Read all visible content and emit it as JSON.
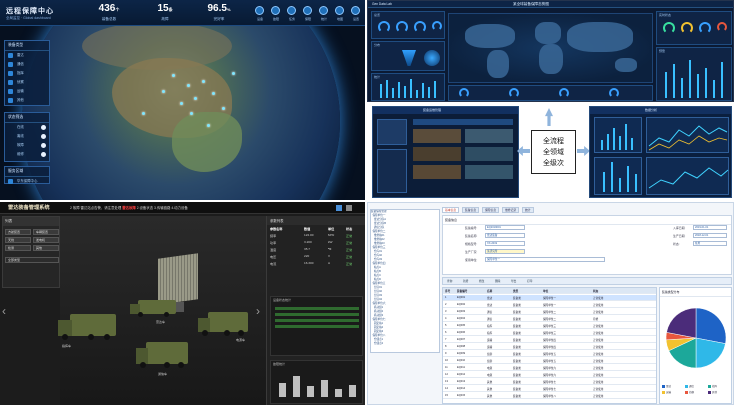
{
  "q1": {
    "title": "远程保障中心",
    "subtitle": "全局监控 · Global dashboard",
    "stats": [
      {
        "num": "436",
        "unit": "个",
        "label": "装备总数"
      },
      {
        "num": "15",
        "unit": "条",
        "label": "故障"
      },
      {
        "num": "96.5",
        "unit": "%",
        "label": "完好率"
      }
    ],
    "top_icons": [
      "设备",
      "故障",
      "任务",
      "保障",
      "统计",
      "地图",
      "设置"
    ],
    "panel1": {
      "title": "装备类型",
      "items": [
        "雷达",
        "通信",
        "指挥",
        "侦察",
        "运输",
        "其他"
      ]
    },
    "panel2": {
      "title": "状态筛选",
      "items": [
        "在线",
        "离线",
        "故障",
        "维修"
      ]
    },
    "panel3": {
      "title": "服务区域",
      "items": [
        "华东保障中心"
      ]
    }
  },
  "q2": {
    "logo": "Gen Data Lab",
    "title": "某全球装备保障态势图",
    "panels_left": [
      "总览",
      "分布",
      "统计"
    ],
    "panels_right": [
      "实时状态",
      "预警"
    ]
  },
  "q3": {
    "center": [
      "全流程",
      "全领域",
      "全级次"
    ],
    "left_title": "装备运维管理",
    "right_title": "数据分析"
  },
  "q4": {
    "title": "雷达装备管理系统",
    "ticker_prefix": "2 故障  雷达站点告警，请注意处理  ",
    "ticker_warn": "雷达故障",
    "ticker_suffix": "  2.设备状态 3.传输链路  4.动力设备",
    "left_header": "列表",
    "buttons": [
      "方舱装置",
      "车辆装置",
      "天线",
      "发电机",
      "检测",
      "其他"
    ],
    "select_label": "全部类型",
    "table_title": "参数列表",
    "table_headers": [
      "参数名称",
      "数值",
      "单位",
      "状态"
    ],
    "table_rows": [
      [
        "频率",
        "122.00",
        "MHz",
        "正常"
      ],
      [
        "功率",
        "3.200",
        "kW",
        "正常"
      ],
      [
        "温度",
        "35.7",
        "℃",
        "正常"
      ],
      [
        "电压",
        "220",
        "V",
        "正常"
      ],
      [
        "电流",
        "16.300",
        "A",
        "正常"
      ]
    ],
    "subpanel1_title": "设备状态统计",
    "subpanel2_title": "故障统计",
    "bar_values": [
      0.45,
      0.7,
      0.35,
      0.55,
      0.25,
      0.4
    ],
    "vehicle_labels": [
      "指挥车",
      "雷达车",
      "电源车",
      "通信车"
    ]
  },
  "q5": {
    "tree_items": [
      "装备保障管理",
      "  保障单位一",
      "    雷达分队A",
      "    雷达分队B",
      "    通信分队",
      "  保障单位二",
      "    维修站01",
      "    维修站02",
      "    维修站03",
      "  保障单位三",
      "    仓库01",
      "    仓库02",
      "    仓库03",
      "  保障单位四",
      "    站点A",
      "    站点B",
      "    站点C",
      "    站点D",
      "  保障单位五",
      "    分队01",
      "    分队02",
      "    分队03",
      "    分队04",
      "  保障单位六",
      "    机动组1",
      "    机动组2",
      "    机动组3",
      "  保障单位七",
      "    固定站1",
      "    固定站2",
      "    固定站3",
      "  保障单位八",
      "    仓储点1",
      "    仓储点2"
    ],
    "tabs": [
      "基本信息",
      "装备信息",
      "保障信息",
      "维修记录",
      "统计"
    ],
    "form_title": "装备信息",
    "fields": [
      {
        "label": "装备编号:",
        "value": "EQ2019001"
      },
      {
        "label": "装备名称:",
        "value": "雷达装备"
      },
      {
        "label": "规格型号:",
        "value": "XX-2019"
      },
      {
        "label": "生产厂家:",
        "value": "某研究所"
      },
      {
        "label": "使用单位:",
        "value": "保障单位一"
      }
    ],
    "fields_right": [
      {
        "label": "入库日期:",
        "value": "2019-01-01"
      },
      {
        "label": "生产日期:",
        "value": "2018-12-01"
      },
      {
        "label": "状态:",
        "value": "在用"
      }
    ],
    "toolbar": [
      "查询",
      "新增",
      "修改",
      "删除",
      "导出",
      "打印"
    ],
    "grid_headers": [
      "序号",
      "装备编号",
      "名称",
      "类型",
      "单位",
      "状态"
    ],
    "grid_rows": [
      [
        "1",
        "EQ001",
        "雷达",
        "装备类",
        "保障单位一",
        "正常使用"
      ],
      [
        "2",
        "EQ002",
        "雷达",
        "装备类",
        "保障单位一",
        "正常使用"
      ],
      [
        "3",
        "EQ003",
        "通信",
        "装备类",
        "保障单位二",
        "正常使用"
      ],
      [
        "4",
        "EQ004",
        "通信",
        "装备类",
        "保障单位二",
        "待修"
      ],
      [
        "5",
        "EQ005",
        "指挥",
        "装备类",
        "保障单位三",
        "正常使用"
      ],
      [
        "6",
        "EQ006",
        "指挥",
        "装备类",
        "保障单位三",
        "正常使用"
      ],
      [
        "7",
        "EQ007",
        "运输",
        "装备类",
        "保障单位四",
        "正常使用"
      ],
      [
        "8",
        "EQ008",
        "运输",
        "装备类",
        "保障单位四",
        "正常使用"
      ],
      [
        "9",
        "EQ009",
        "侦察",
        "装备类",
        "保障单位五",
        "正常使用"
      ],
      [
        "10",
        "EQ010",
        "侦察",
        "装备类",
        "保障单位五",
        "正常使用"
      ],
      [
        "11",
        "EQ011",
        "电源",
        "装备类",
        "保障单位六",
        "正常使用"
      ],
      [
        "12",
        "EQ012",
        "电源",
        "装备类",
        "保障单位六",
        "正常使用"
      ],
      [
        "13",
        "EQ013",
        "其他",
        "装备类",
        "保障单位七",
        "正常使用"
      ],
      [
        "14",
        "EQ014",
        "其他",
        "装备类",
        "保障单位七",
        "正常使用"
      ],
      [
        "15",
        "EQ015",
        "其他",
        "装备类",
        "保障单位八",
        "正常使用"
      ]
    ],
    "pie_title": "装备类型分布",
    "pie": [
      {
        "label": "雷达",
        "value": 28,
        "color": "#1e63c6"
      },
      {
        "label": "通信",
        "value": 22,
        "color": "#2fb8e8"
      },
      {
        "label": "指挥",
        "value": 18,
        "color": "#1ca89a"
      },
      {
        "label": "运输",
        "value": 6,
        "color": "#f2c230"
      },
      {
        "label": "侦察",
        "value": 4,
        "color": "#e8573e"
      },
      {
        "label": "其他",
        "value": 22,
        "color": "#4b2c7a"
      }
    ]
  }
}
